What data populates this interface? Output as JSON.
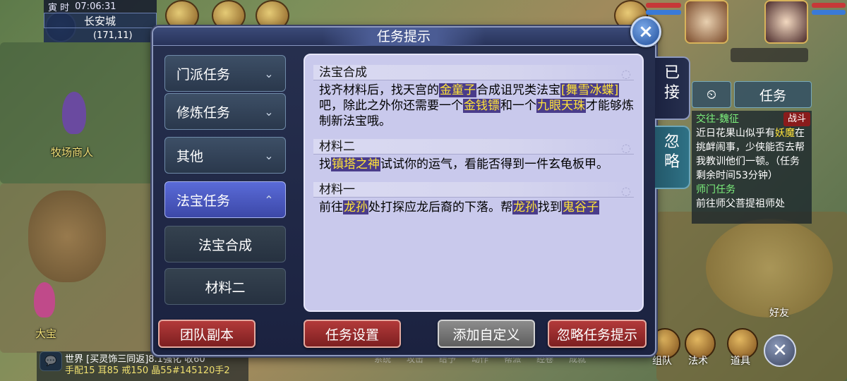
{
  "status": {
    "time_label": "寅 时",
    "clock": "07:06:31",
    "location_name": "长安城",
    "coords": "(171,11)"
  },
  "world": {
    "npc1": "牧场商人",
    "npc2": "大宝",
    "friend_label": "好友"
  },
  "side_panel": {
    "tab_label": "任务",
    "quest1_title": "交往-魏征",
    "quest1_badge": "战斗",
    "quest1_text_a": "近日花果山似乎有",
    "quest1_hl": "妖魔",
    "quest1_text_b": "在挑衅闹事，少侠能否去帮我教训他们一顿。（任务剩余时间53分钟）",
    "quest2_title": "师门任务",
    "quest2_text": "前往师父菩提祖师处"
  },
  "chat": {
    "icon": "chat-bubble-icon",
    "line1": "世界 [买灵饰三同返]8.1强化 收60",
    "line2": "手配15 耳85 戒150 晶55#145120手2"
  },
  "bottom_menu": [
    "系统",
    "攻击",
    "给予",
    "动作",
    "帮派",
    "经卷",
    "成就",
    "组队",
    "法术",
    "道具"
  ],
  "dialog": {
    "title": "任务提示",
    "close": "×",
    "tab_accepted": "已接",
    "tab_ignored": "忽略",
    "nav": [
      {
        "label": "门派任务",
        "chevron": "⌄"
      },
      {
        "label": "修炼任务",
        "chevron": "⌄"
      },
      {
        "label": "其他",
        "chevron": "⌄"
      },
      {
        "label": "法宝任务",
        "chevron": "⌃"
      }
    ],
    "nav_sub": [
      "法宝合成",
      "材料二"
    ],
    "sections": [
      {
        "title": "法宝合成",
        "parts": [
          "找齐材料后，找天宫的",
          "金童子",
          "合成诅咒类法宝",
          "[舞雪冰蝶]",
          "吧，除此之外你还需要一个",
          "金钱镖",
          "和一个",
          "九眼天珠",
          "才能够炼制新法宝哦。"
        ]
      },
      {
        "title": "材料二",
        "parts": [
          "找",
          "镇塔之神",
          "试试你的运气，看能否得到一件玄龟板甲。"
        ]
      },
      {
        "title": "材料一",
        "parts": [
          "前往",
          "龙孙",
          "处打探应龙后裔的下落。帮",
          "龙孙",
          "找到",
          "鬼谷子"
        ]
      }
    ],
    "buttons": {
      "team_dungeon": "团队副本",
      "quest_settings": "任务设置",
      "add_custom": "添加自定义",
      "ignore_hint": "忽略任务提示"
    }
  },
  "colors": {
    "highlight_text": "#ffe338",
    "highlight_bg": "#4a3c8a",
    "nav_active": "#4b58c4",
    "button_red": "#9a2b2c"
  }
}
